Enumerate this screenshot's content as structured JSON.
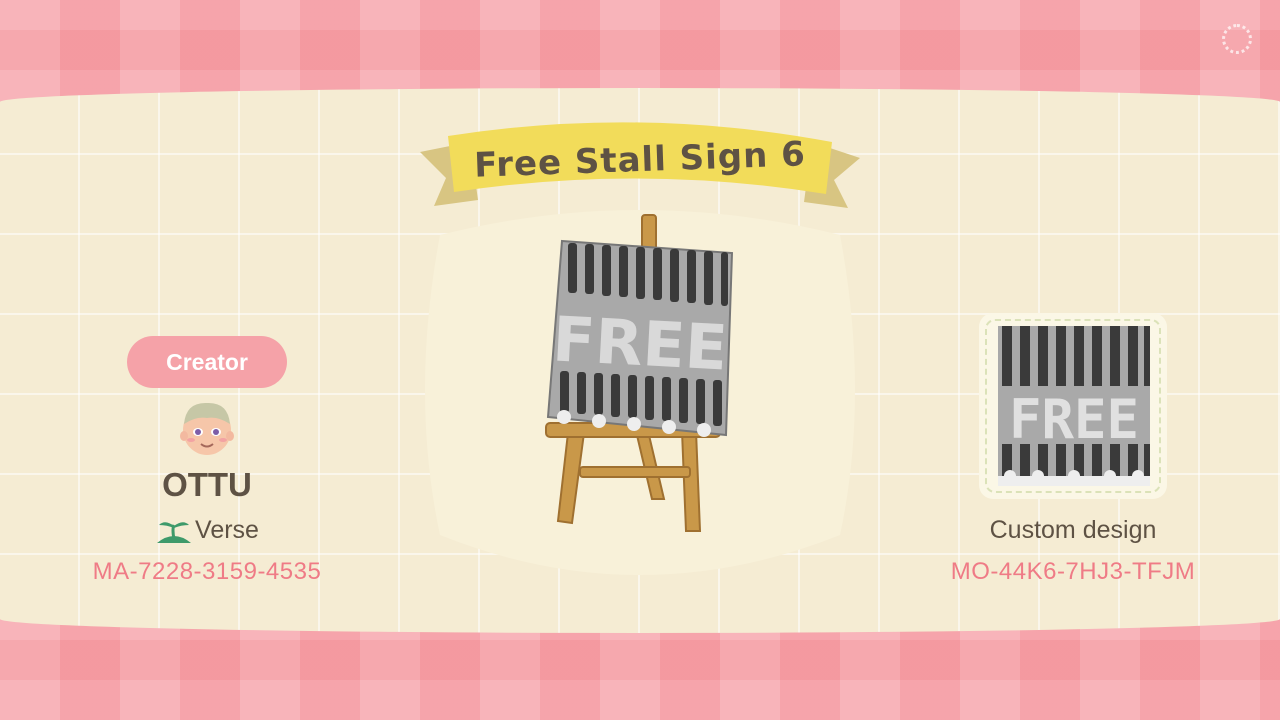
{
  "design": {
    "title": "Free Stall Sign 6",
    "sign_text": "FREE"
  },
  "creator": {
    "label": "Creator",
    "name": "OTTU",
    "island": "Verse",
    "id": "MA-7228-3159-4535"
  },
  "design_info": {
    "type_label": "Custom design",
    "id": "MO-44K6-7HJ3-TFJM"
  },
  "icons": {
    "loading": "loading-spinner-icon",
    "island": "island-sprout-icon",
    "avatar": "villager-avatar-icon"
  },
  "colors": {
    "pink": "#f6a3a9",
    "cream": "#f5ecd3",
    "banner_yellow": "#f2dc5a",
    "id_pink": "#ef7b86",
    "text_brown": "#5e5244"
  }
}
